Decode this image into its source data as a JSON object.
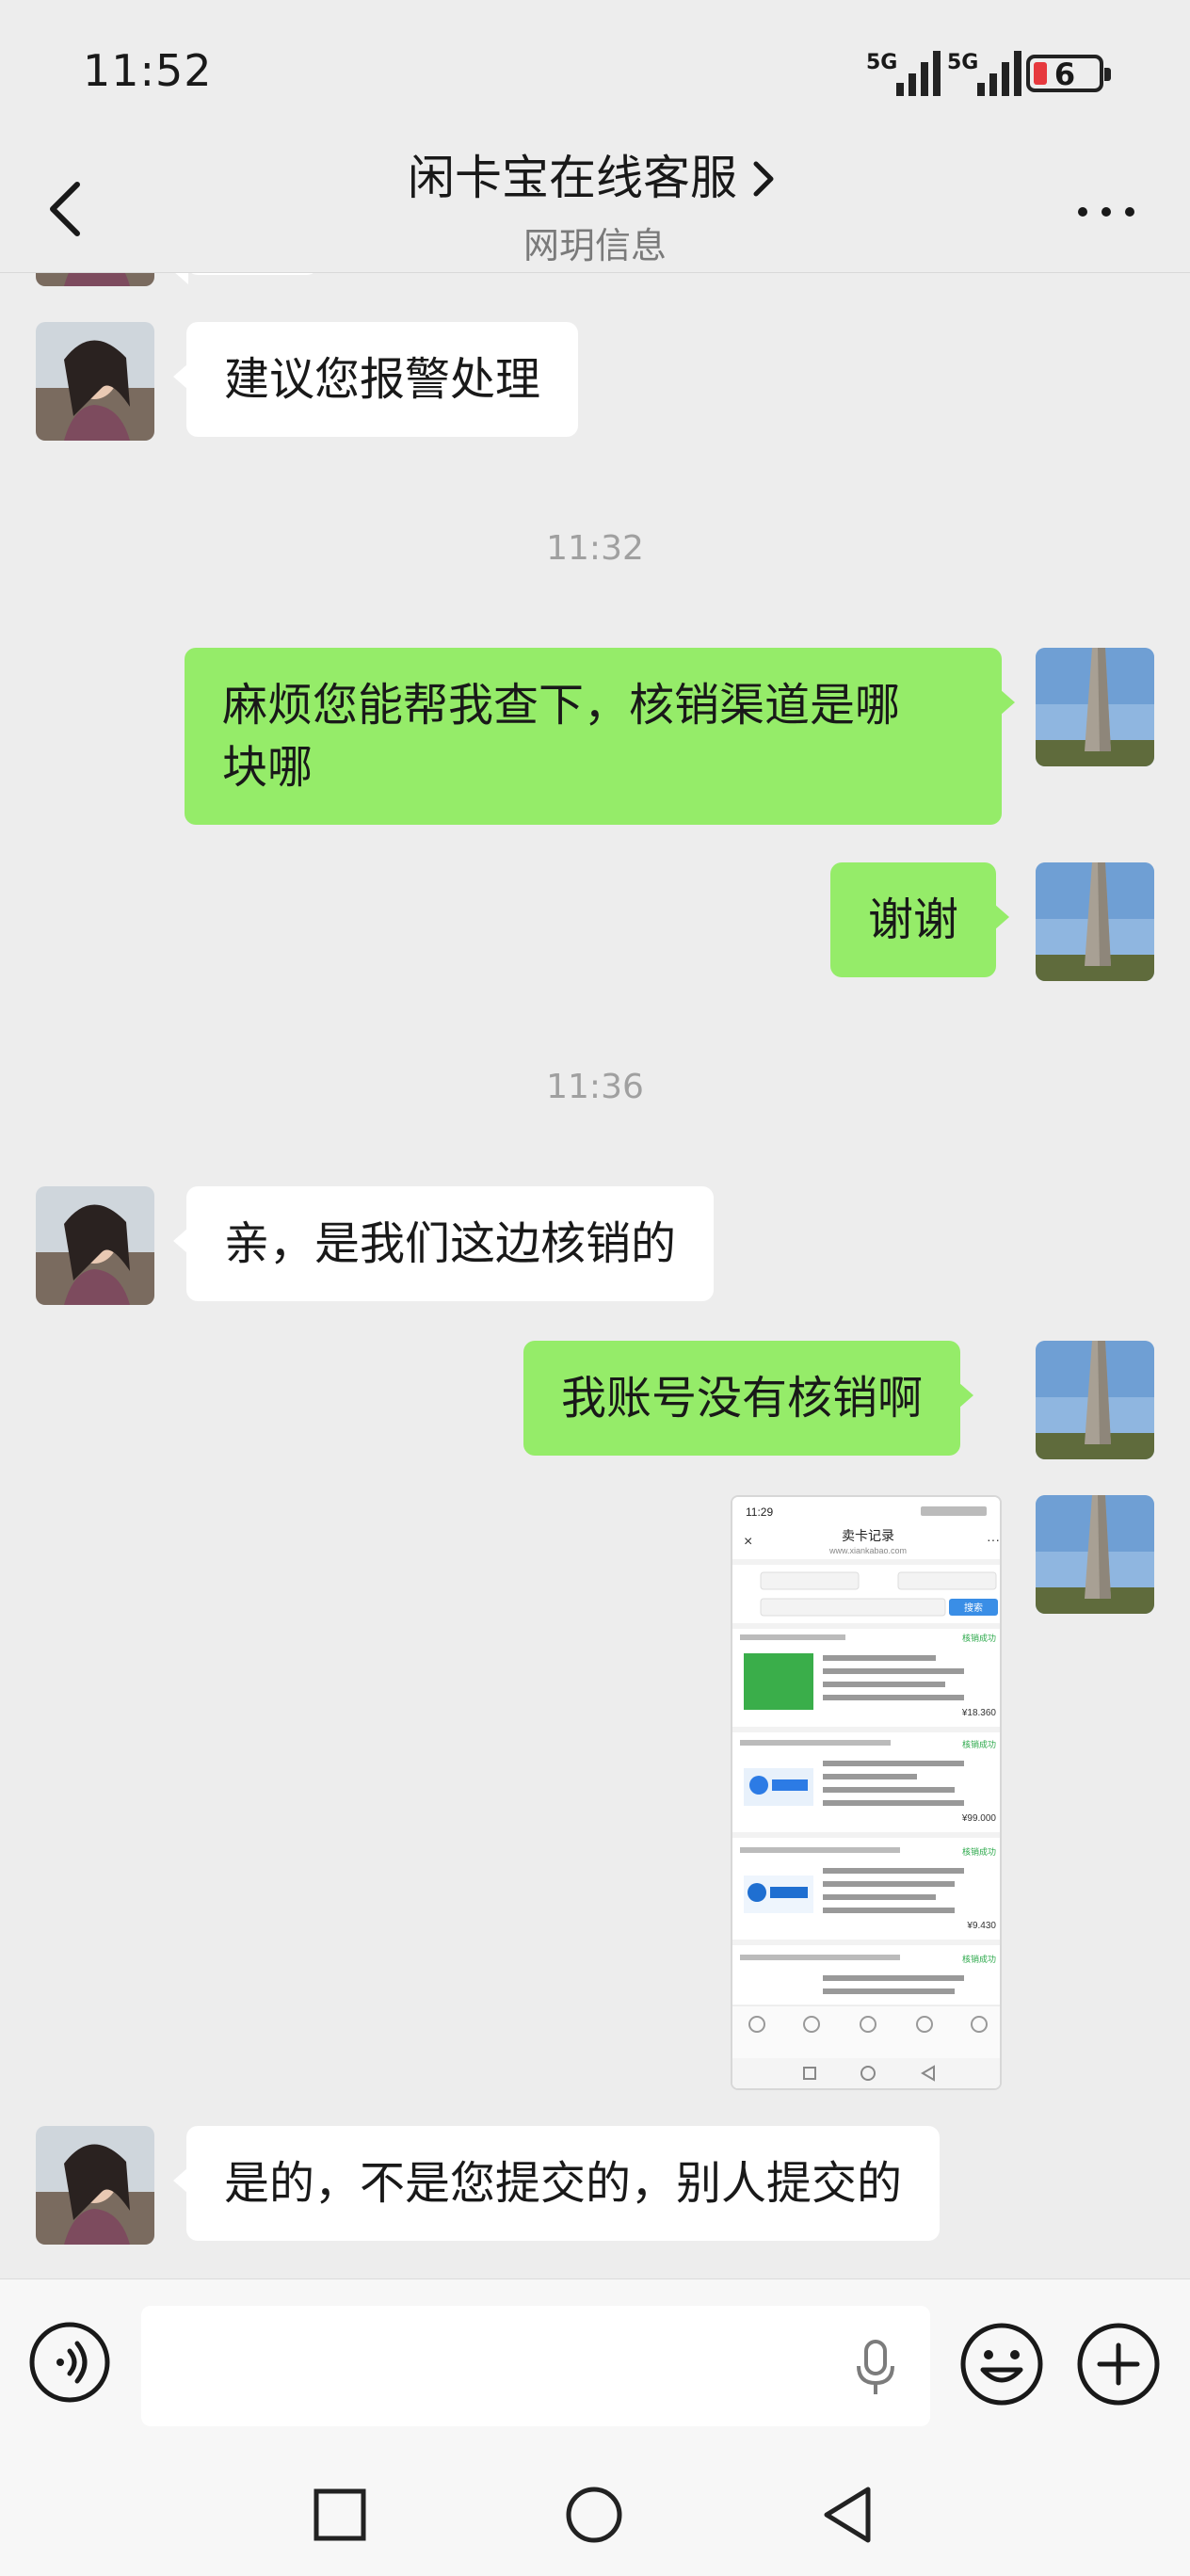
{
  "status_bar": {
    "time": "11:52",
    "signal_1_label": "5G",
    "signal_2_label": "5G",
    "battery_level": "6"
  },
  "header": {
    "title": "闲卡宝在线客服",
    "subtitle": "网玥信息"
  },
  "messages": [
    {
      "from": "agent",
      "text": "建议您报警处理"
    },
    {
      "type": "timestamp",
      "text": "11:32"
    },
    {
      "from": "me",
      "text": "麻烦您能帮我查下，核销渠道是哪\n块哪"
    },
    {
      "from": "me",
      "text": "谢谢"
    },
    {
      "type": "timestamp",
      "text": "11:36"
    },
    {
      "from": "agent",
      "text": "亲，是我们这边核销的"
    },
    {
      "from": "me",
      "text": "我账号没有核销啊"
    },
    {
      "from": "me",
      "type": "image",
      "text": ""
    },
    {
      "from": "agent",
      "text": "是的，不是您提交的，别人提交的"
    }
  ],
  "screenshot_thumb": {
    "time": "11:29",
    "title": "卖卡记录",
    "url": "www.xiankabao.com",
    "search_button": "搜索",
    "cards": [
      {
        "status": "核销成功",
        "amount": "¥18.360"
      },
      {
        "status": "核销成功",
        "amount": "¥99.000"
      },
      {
        "status": "核销成功",
        "amount": "¥9.430"
      },
      {
        "status": "核销成功",
        "amount": ""
      }
    ]
  },
  "input_bar": {
    "placeholder": ""
  },
  "colors": {
    "background": "#ededed",
    "bubble_out": "#95ec69",
    "bubble_in": "#ffffff",
    "battery_low": "#e6393e"
  }
}
